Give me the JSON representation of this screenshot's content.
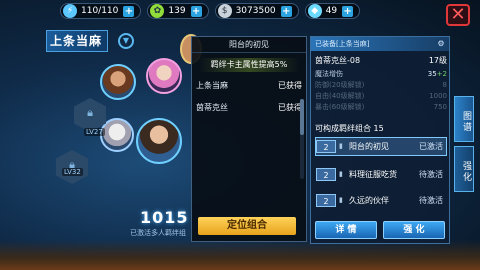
{
  "topbar": {
    "stamina": "110/110",
    "currency2": "139",
    "gold": "3073500",
    "gems": "49"
  },
  "left": {
    "character_name": "上条当麻",
    "levels": [
      "LV27",
      "LV32"
    ],
    "score": "1015",
    "score_note": "已激活多人羁绊组"
  },
  "middle": {
    "header": "阳台的初见",
    "effect": "羁绊卡主属性提高5%",
    "rows": [
      {
        "name": "上条当麻",
        "status": "已获得"
      },
      {
        "name": "茵蒂克丝",
        "status": "已获得"
      }
    ],
    "locate_button": "定位组合"
  },
  "card": {
    "tag": "已装备[上条当麻]",
    "name": "茵蒂克丝-08",
    "level": "17级",
    "stats": [
      {
        "label": "魔法增伤",
        "value": "35",
        "bonus": "+2"
      },
      {
        "label": "防御(20级解锁)",
        "value": "8",
        "bonus": ""
      },
      {
        "label": "自由(40级解锁)",
        "value": "1000",
        "bonus": ""
      },
      {
        "label": "暴击(60级解锁)",
        "value": "750",
        "bonus": ""
      }
    ],
    "combo_title": "可构成羁绊组合 15",
    "combos": [
      {
        "num": "2",
        "name": "阳台的初见",
        "status": "已激活"
      },
      {
        "num": "2",
        "name": "料理征服吃货",
        "status": "待激活"
      },
      {
        "num": "2",
        "name": "久远的伙伴",
        "status": "待激活"
      }
    ],
    "detail_button": "详 情",
    "enhance_button": "强 化"
  },
  "side_tabs": [
    "图谱",
    "强化"
  ]
}
